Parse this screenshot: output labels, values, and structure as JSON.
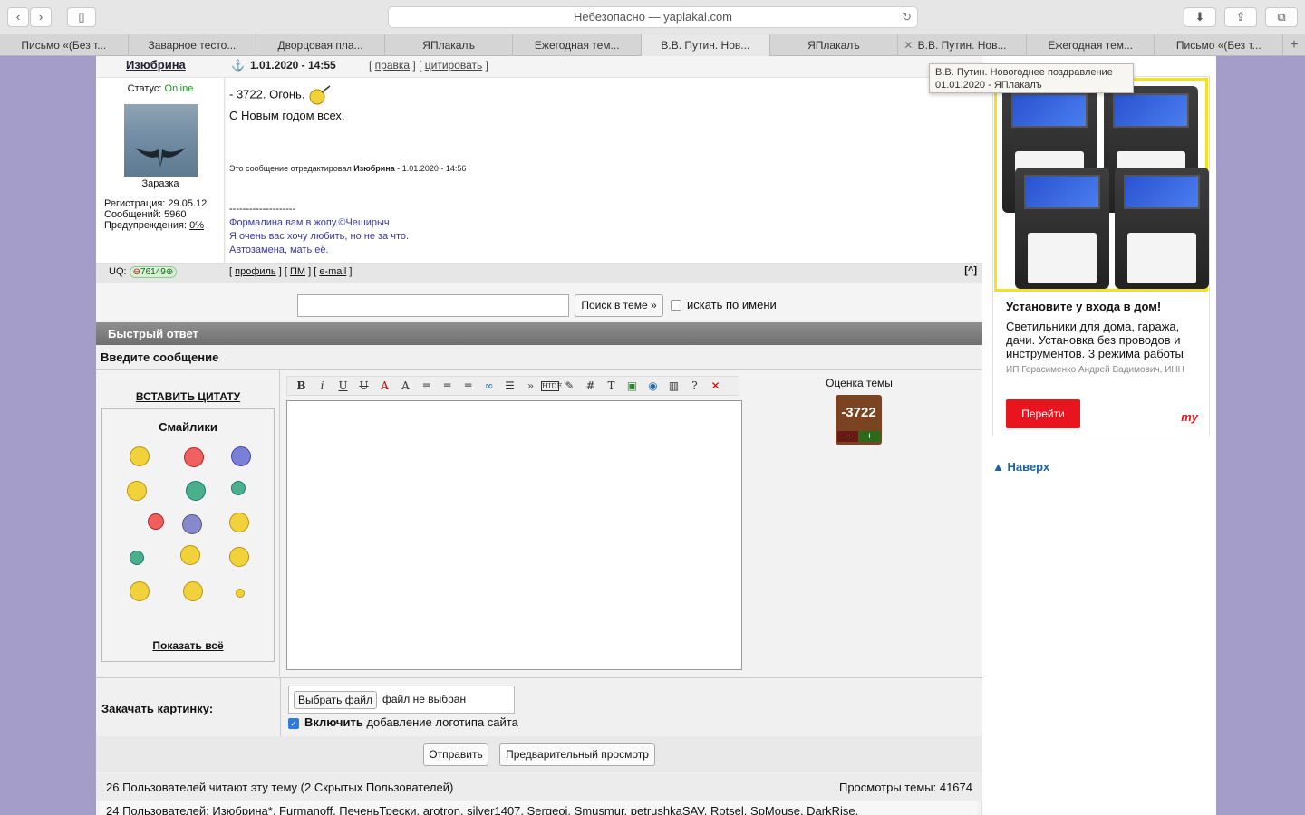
{
  "browser": {
    "url": "Небезопасно — yaplakal.com",
    "tabs": [
      "Письмо «(Без т...",
      "Заварное тесто...",
      "Дворцовая пла...",
      "ЯПлакалъ",
      "Ежегодная тем...",
      "В.В. Путин. Нов...",
      "ЯПлакалъ",
      "В.В. Путин. Нов...",
      "Ежегодная тем...",
      "Письмо «(Без т..."
    ],
    "tooltip_line1": "В.В. Путин. Новогоднее поздравление",
    "tooltip_line2": "01.01.2020 - ЯПлакалъ"
  },
  "post": {
    "author": "Изюбрина",
    "date": "1.01.2020 - 14:55",
    "edit_link": "правка",
    "quote_link": "цитировать",
    "status_label": "Статус:",
    "status_value": "Online",
    "user_title": "Заразка",
    "reg": "Регистрация: 29.05.12",
    "messages": "Сообщений: 5960",
    "warnings_label": "Предупреждения:",
    "warnings_value": "0%",
    "line1": "- 3722. Огонь.",
    "line2": "С Новым годом всех.",
    "edited_prefix": "Это сообщение отредактировал",
    "edited_user": "Изюбрина",
    "edited_date": "- 1.01.2020 - 14:56",
    "sig_sep": "--------------------",
    "sig1": "Формалина вам в жопу.©Чеширыч",
    "sig2": "Я очень вас хочу любить, но не за что.",
    "sig3": "Автозамена, мать её.",
    "uq_label": "UQ:",
    "uq_value": "76149",
    "profile": "профиль",
    "pm": "ПМ",
    "email": "e-mail",
    "top": "[^]"
  },
  "search": {
    "button": "Поиск в теме »",
    "by_name": "искать по имени"
  },
  "reply": {
    "header": "Быстрый ответ",
    "enter_msg": "Введите сообщение",
    "insert_quote": "ВСТАВИТЬ ЦИТАТУ",
    "smilies": "Смайлики",
    "show_all": "Показать всё",
    "rating_title": "Оценка темы",
    "rating_value": "-3722",
    "upload_label": "Закачать картинку:",
    "choose_file": "Выбрать файл",
    "no_file": "файл не выбран",
    "logo_bold": "Включить",
    "logo_rest": "добавление логотипа сайта",
    "send": "Отправить",
    "preview": "Предварительный просмотр"
  },
  "footer": {
    "readers": "26 Пользователей читают эту тему (2 Скрытых Пользователей)",
    "views": "Просмотры темы: 41674",
    "users": "24 Пользователей: Изюбрина*, Furmanoff, ПеченьТрески, arotron, silver1407, Sergeoi, Smusmur, petrushkaSAV, Rotsel, SpMouse, DarkRise,"
  },
  "ad": {
    "title": "Установите у входа в дом!",
    "desc": "Светильники для дома, гаража, дачи. Установка без проводов и инструментов. 3 режима работы",
    "seller": "ИП Герасименко Андрей Вадимович, ИНН",
    "button": "Перейти",
    "logo": "my"
  },
  "side": {
    "top_link": "Наверх"
  }
}
